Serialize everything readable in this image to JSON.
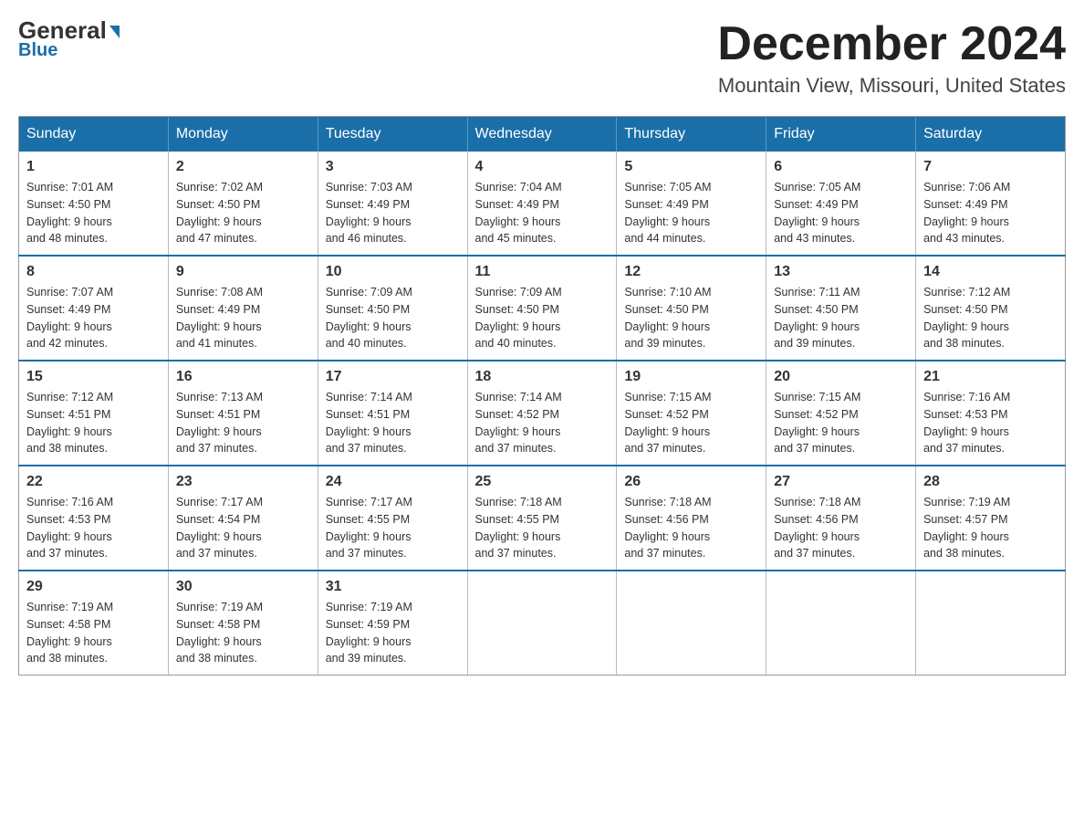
{
  "logo": {
    "general": "General",
    "blue": "Blue",
    "arrow": "▶"
  },
  "title": {
    "month": "December 2024",
    "location": "Mountain View, Missouri, United States"
  },
  "days_header": [
    "Sunday",
    "Monday",
    "Tuesday",
    "Wednesday",
    "Thursday",
    "Friday",
    "Saturday"
  ],
  "weeks": [
    [
      {
        "day": "1",
        "sunrise": "7:01 AM",
        "sunset": "4:50 PM",
        "daylight": "9 hours and 48 minutes."
      },
      {
        "day": "2",
        "sunrise": "7:02 AM",
        "sunset": "4:50 PM",
        "daylight": "9 hours and 47 minutes."
      },
      {
        "day": "3",
        "sunrise": "7:03 AM",
        "sunset": "4:49 PM",
        "daylight": "9 hours and 46 minutes."
      },
      {
        "day": "4",
        "sunrise": "7:04 AM",
        "sunset": "4:49 PM",
        "daylight": "9 hours and 45 minutes."
      },
      {
        "day": "5",
        "sunrise": "7:05 AM",
        "sunset": "4:49 PM",
        "daylight": "9 hours and 44 minutes."
      },
      {
        "day": "6",
        "sunrise": "7:05 AM",
        "sunset": "4:49 PM",
        "daylight": "9 hours and 43 minutes."
      },
      {
        "day": "7",
        "sunrise": "7:06 AM",
        "sunset": "4:49 PM",
        "daylight": "9 hours and 43 minutes."
      }
    ],
    [
      {
        "day": "8",
        "sunrise": "7:07 AM",
        "sunset": "4:49 PM",
        "daylight": "9 hours and 42 minutes."
      },
      {
        "day": "9",
        "sunrise": "7:08 AM",
        "sunset": "4:49 PM",
        "daylight": "9 hours and 41 minutes."
      },
      {
        "day": "10",
        "sunrise": "7:09 AM",
        "sunset": "4:50 PM",
        "daylight": "9 hours and 40 minutes."
      },
      {
        "day": "11",
        "sunrise": "7:09 AM",
        "sunset": "4:50 PM",
        "daylight": "9 hours and 40 minutes."
      },
      {
        "day": "12",
        "sunrise": "7:10 AM",
        "sunset": "4:50 PM",
        "daylight": "9 hours and 39 minutes."
      },
      {
        "day": "13",
        "sunrise": "7:11 AM",
        "sunset": "4:50 PM",
        "daylight": "9 hours and 39 minutes."
      },
      {
        "day": "14",
        "sunrise": "7:12 AM",
        "sunset": "4:50 PM",
        "daylight": "9 hours and 38 minutes."
      }
    ],
    [
      {
        "day": "15",
        "sunrise": "7:12 AM",
        "sunset": "4:51 PM",
        "daylight": "9 hours and 38 minutes."
      },
      {
        "day": "16",
        "sunrise": "7:13 AM",
        "sunset": "4:51 PM",
        "daylight": "9 hours and 37 minutes."
      },
      {
        "day": "17",
        "sunrise": "7:14 AM",
        "sunset": "4:51 PM",
        "daylight": "9 hours and 37 minutes."
      },
      {
        "day": "18",
        "sunrise": "7:14 AM",
        "sunset": "4:52 PM",
        "daylight": "9 hours and 37 minutes."
      },
      {
        "day": "19",
        "sunrise": "7:15 AM",
        "sunset": "4:52 PM",
        "daylight": "9 hours and 37 minutes."
      },
      {
        "day": "20",
        "sunrise": "7:15 AM",
        "sunset": "4:52 PM",
        "daylight": "9 hours and 37 minutes."
      },
      {
        "day": "21",
        "sunrise": "7:16 AM",
        "sunset": "4:53 PM",
        "daylight": "9 hours and 37 minutes."
      }
    ],
    [
      {
        "day": "22",
        "sunrise": "7:16 AM",
        "sunset": "4:53 PM",
        "daylight": "9 hours and 37 minutes."
      },
      {
        "day": "23",
        "sunrise": "7:17 AM",
        "sunset": "4:54 PM",
        "daylight": "9 hours and 37 minutes."
      },
      {
        "day": "24",
        "sunrise": "7:17 AM",
        "sunset": "4:55 PM",
        "daylight": "9 hours and 37 minutes."
      },
      {
        "day": "25",
        "sunrise": "7:18 AM",
        "sunset": "4:55 PM",
        "daylight": "9 hours and 37 minutes."
      },
      {
        "day": "26",
        "sunrise": "7:18 AM",
        "sunset": "4:56 PM",
        "daylight": "9 hours and 37 minutes."
      },
      {
        "day": "27",
        "sunrise": "7:18 AM",
        "sunset": "4:56 PM",
        "daylight": "9 hours and 37 minutes."
      },
      {
        "day": "28",
        "sunrise": "7:19 AM",
        "sunset": "4:57 PM",
        "daylight": "9 hours and 38 minutes."
      }
    ],
    [
      {
        "day": "29",
        "sunrise": "7:19 AM",
        "sunset": "4:58 PM",
        "daylight": "9 hours and 38 minutes."
      },
      {
        "day": "30",
        "sunrise": "7:19 AM",
        "sunset": "4:58 PM",
        "daylight": "9 hours and 38 minutes."
      },
      {
        "day": "31",
        "sunrise": "7:19 AM",
        "sunset": "4:59 PM",
        "daylight": "9 hours and 39 minutes."
      },
      null,
      null,
      null,
      null
    ]
  ]
}
